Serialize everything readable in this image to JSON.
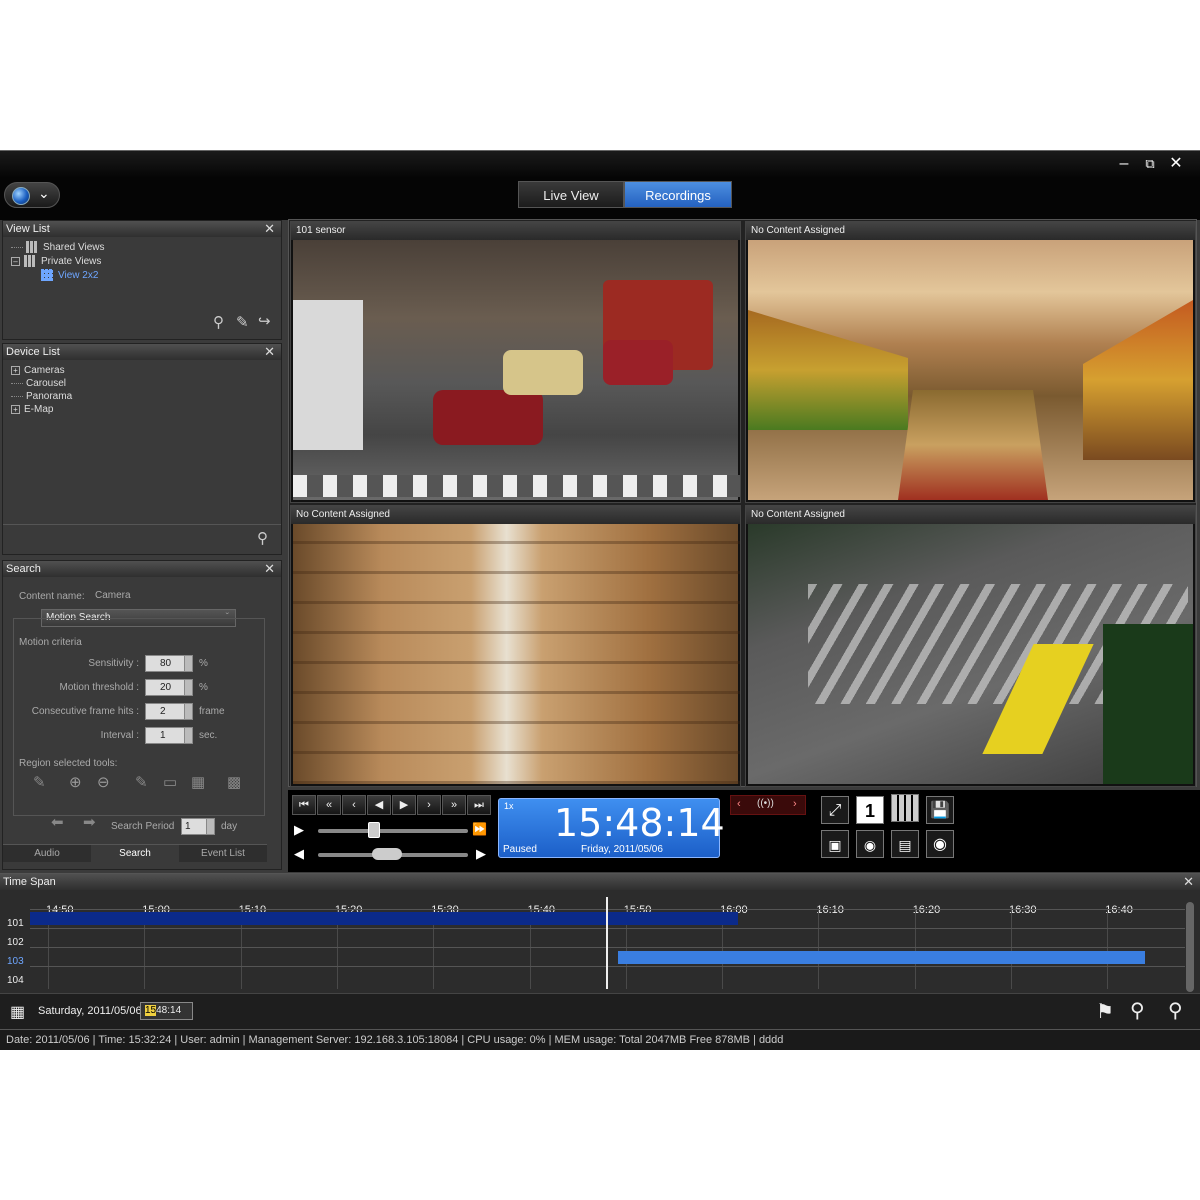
{
  "window": {
    "minimize_icon": "minimize-icon",
    "restore_icon": "restore-icon",
    "close_icon": "close-icon"
  },
  "mode_tabs": {
    "live_view": "Live View",
    "recordings": "Recordings",
    "active": "Recordings"
  },
  "view_list": {
    "title": "View List",
    "items": [
      "Shared Views",
      "Private Views",
      "View 2x2"
    ]
  },
  "device_list": {
    "title": "Device List",
    "items": [
      "Cameras",
      "Carousel",
      "Panorama",
      "E-Map"
    ]
  },
  "search": {
    "title": "Search",
    "content_name_label": "Content name:",
    "content_name_value": "Camera",
    "search_type": "Motion Search",
    "motion_criteria_label": "Motion criteria",
    "sensitivity_label": "Sensitivity :",
    "sensitivity_value": "80",
    "sensitivity_unit": "%",
    "threshold_label": "Motion threshold :",
    "threshold_value": "20",
    "threshold_unit": "%",
    "frame_hits_label": "Consecutive frame hits :",
    "frame_hits_value": "2",
    "frame_hits_unit": "frame",
    "interval_label": "Interval :",
    "interval_value": "1",
    "interval_unit": "sec.",
    "region_tools_label": "Region selected tools:",
    "search_period_label": "Search Period",
    "search_period_value": "1",
    "search_period_unit": "day"
  },
  "bottom_tabs": [
    "Audio",
    "Search",
    "Event List"
  ],
  "video_cells": [
    {
      "title": "101  sensor"
    },
    {
      "title": "No Content Assigned"
    },
    {
      "title": "No Content Assigned"
    },
    {
      "title": "No Content Assigned"
    }
  ],
  "playback": {
    "speed": "1x",
    "time": "15:48:14",
    "state": "Paused",
    "date": "Friday, 2011/05/06",
    "layout_number": "1"
  },
  "time_span": {
    "title": "Time Span",
    "ticks": [
      "14:50",
      "15:00",
      "15:10",
      "15:20",
      "15:30",
      "15:40",
      "15:50",
      "16:00",
      "16:10",
      "16:20",
      "16:30",
      "16:40"
    ],
    "tracks": [
      "101",
      "102",
      "103",
      "104"
    ],
    "date_label": "Saturday, 2011/05/06",
    "time_value_hh": "15",
    "time_value_rest": "48:14"
  },
  "status": "Date: 2011/05/06  |  Time: 15:32:24  |  User: admin  |  Management Server: 192.168.3.105:18084  |  CPU usage: 0%  |  MEM usage: Total 2047MB  Free 878MB  |  dddd",
  "colors": {
    "accent": "#2f72d6",
    "track_dark": "#0b2a8a",
    "track_light": "#3a7ee0"
  }
}
